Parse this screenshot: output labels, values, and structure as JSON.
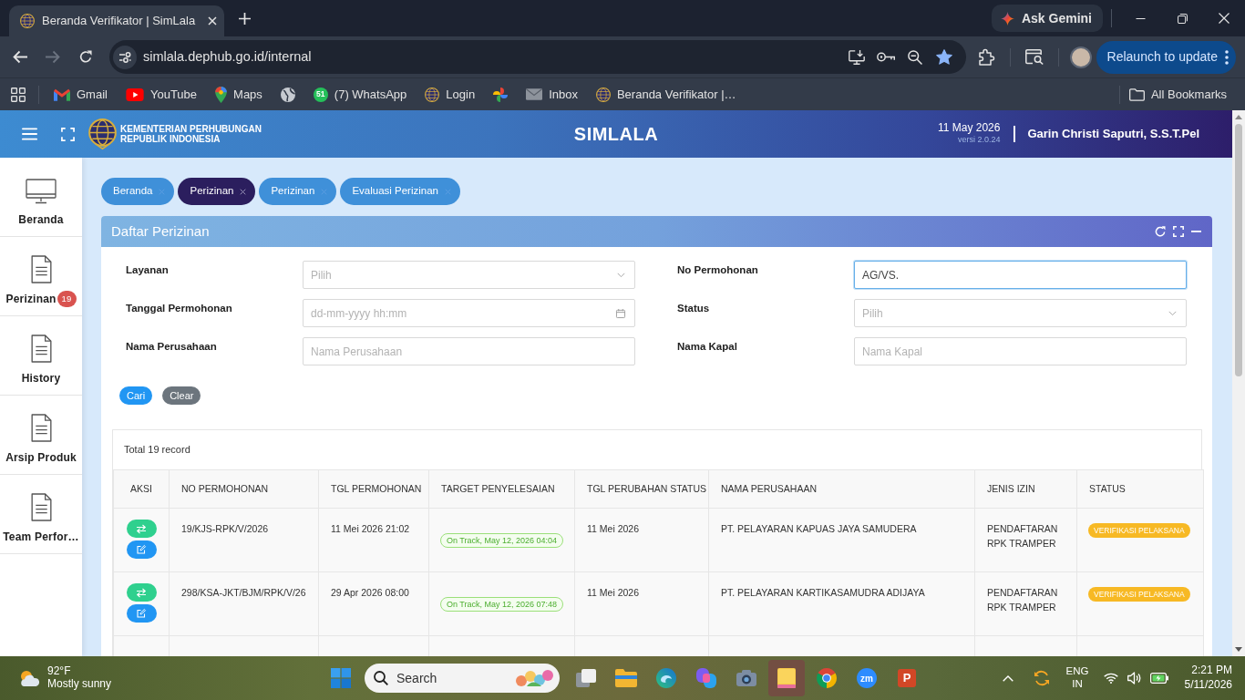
{
  "browser": {
    "tab_title": "Beranda Verifikator | SimLala",
    "ask_gemini": "Ask Gemini",
    "nav": [
      {
        "kind": "back",
        "disabled": false
      },
      {
        "kind": "forward",
        "disabled": true
      },
      {
        "kind": "reload",
        "disabled": false
      }
    ],
    "url": "simlala.dephub.go.id/internal",
    "bookmarked": true,
    "relaunch": "Relaunch to update",
    "bookmarks": [
      {
        "kind": "gmail",
        "label": "Gmail"
      },
      {
        "kind": "youtube",
        "label": "YouTube"
      },
      {
        "kind": "maps",
        "label": "Maps"
      },
      {
        "kind": "globe"
      },
      {
        "kind": "whatsapp",
        "badge": "51",
        "label": "(7) WhatsApp"
      },
      {
        "kind": "site",
        "label": "Login"
      },
      {
        "kind": "pinwheel"
      },
      {
        "kind": "mail",
        "label": "Inbox"
      },
      {
        "kind": "site",
        "label": "Beranda Verifikator |…"
      }
    ],
    "all_bookmarks": "All Bookmarks"
  },
  "header": {
    "org": [
      "KEMENTERIAN PERHUBUNGAN",
      "REPUBLIK INDONESIA"
    ],
    "title": "SIMLALA",
    "date": "11 May 2026",
    "version": "versi 2.0.24",
    "user": "Garin Christi Saputri, S.S.T.Pel"
  },
  "sidebar": {
    "items": [
      {
        "kind": "monitor",
        "label": "Beranda"
      },
      {
        "kind": "document",
        "label": "Perizinan",
        "badge": "19"
      },
      {
        "kind": "document",
        "label": "History"
      },
      {
        "kind": "document",
        "label": "Arsip Produk"
      },
      {
        "kind": "document",
        "label": "Team Perfor…"
      }
    ]
  },
  "tabs": [
    {
      "label": "Beranda",
      "selected": false
    },
    {
      "label": "Perizinan",
      "selected": true
    },
    {
      "label": "Perizinan",
      "selected": false
    },
    {
      "label": "Evaluasi Perizinan",
      "selected": false
    }
  ],
  "panel": {
    "title": "Daftar Perizinan",
    "filter_columns": [
      [
        {
          "label": "Layanan",
          "kind": "select",
          "placeholder": "Pilih",
          "focused": false
        },
        {
          "label": "Tanggal Permohonan",
          "kind": "date",
          "placeholder": "dd-mm-yyyy hh:mm",
          "focused": false
        },
        {
          "label": "Nama Perusahaan",
          "kind": "text",
          "placeholder": "Nama Perusahaan",
          "focused": false
        }
      ],
      [
        {
          "label": "No Permohonan",
          "kind": "text",
          "value": "AG/VS.",
          "focused": true
        },
        {
          "label": "Status",
          "kind": "select",
          "placeholder": "Pilih",
          "focused": false
        },
        {
          "label": "Nama Kapal",
          "kind": "text",
          "placeholder": "Nama Kapal",
          "focused": false
        }
      ]
    ],
    "buttons": [
      {
        "label": "Cari",
        "kind": "primary"
      },
      {
        "label": "Clear",
        "kind": "secondary"
      }
    ],
    "table": {
      "total": "Total 19 record",
      "columns": [
        "AKSI",
        "NO PERMOHONAN",
        "TGL PERMOHONAN",
        "TARGET PENYELESAIAN",
        "TGL PERUBAHAN STATUS",
        "NAMA PERUSAHAAN",
        "JENIS IZIN",
        "STATUS"
      ],
      "rows": [
        {
          "no_permohonan": "19/KJS-RPK/V/2026",
          "tgl_permohonan": "11 Mei 2026 21:02",
          "target": "On Track, May 12, 2026 04:04",
          "tgl_perubahan_status": "11 Mei 2026",
          "nama_perusahaan": "PT. PELAYARAN KAPUAS JAYA SAMUDERA",
          "jenis_izin": "PENDAFTARAN RPK TRAMPER",
          "status": "VERIFIKASI PELAKSANA"
        },
        {
          "no_permohonan": "298/KSA-JKT/BJM/RPK/V/26",
          "tgl_permohonan": "29 Apr 2026 08:00",
          "target": "On Track, May 12, 2026 07:48",
          "tgl_perubahan_status": "11 Mei 2026",
          "nama_perusahaan": "PT. PELAYARAN KARTIKASAMUDRA ADIJAYA",
          "jenis_izin": "PENDAFTARAN RPK TRAMPER",
          "status": "VERIFIKASI PELAKSANA"
        }
      ]
    }
  },
  "taskbar": {
    "weather": {
      "temp": "92°F",
      "condition": "Mostly sunny"
    },
    "search": "Search",
    "apps": [
      {
        "kind": "taskview",
        "active": false
      },
      {
        "kind": "explorer",
        "active": false
      },
      {
        "kind": "edge",
        "active": false
      },
      {
        "kind": "copilot",
        "active": false
      },
      {
        "kind": "camera",
        "active": false
      },
      {
        "kind": "notes",
        "active": true
      },
      {
        "kind": "chrome",
        "active": false
      },
      {
        "kind": "zoom",
        "glyph": "zm",
        "active": false
      },
      {
        "kind": "powerpoint",
        "glyph": "P",
        "active": false
      }
    ],
    "language": {
      "lang": "ENG",
      "region": "IN"
    },
    "time": "2:21 PM",
    "date": "5/11/2026"
  }
}
